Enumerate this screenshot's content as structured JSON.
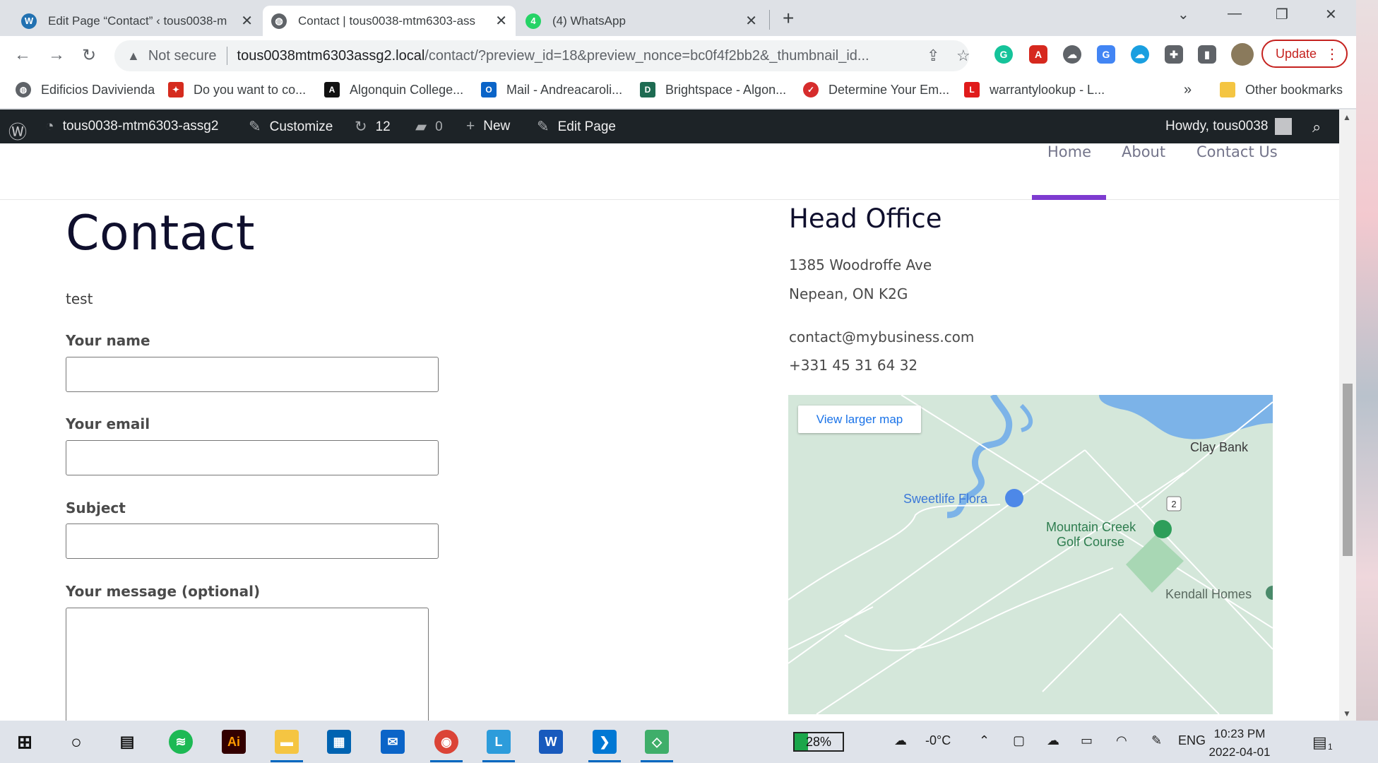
{
  "browser": {
    "tabs": [
      {
        "title": "Edit Page “Contact” ‹ tous0038-m",
        "icon": "wordpress-icon"
      },
      {
        "title": "Contact | tous0038-mtm6303-ass",
        "icon": "globe-icon"
      },
      {
        "title": "(4) WhatsApp",
        "icon": "whatsapp-icon"
      }
    ],
    "security_label": "Not secure",
    "url_host": "tous0038mtm6303assg2.local",
    "url_path": "/contact/?preview_id=18&preview_nonce=bc0f4f2bb2&_thumbnail_id...",
    "update_label": "Update",
    "bookmarks": [
      "Edificios Davivienda",
      "Do you want to co...",
      "Algonquin College...",
      "Mail - Andreacaroli...",
      "Brightspace - Algon...",
      "Determine Your Em...",
      "warrantylookup - L..."
    ],
    "bookmarks_overflow": "»",
    "other_bookmarks": "Other bookmarks"
  },
  "wp_admin_bar": {
    "site_name": "tous0038-mtm6303-assg2",
    "customize": "Customize",
    "updates_count": "12",
    "comments_count": "0",
    "new_label": "New",
    "edit_page": "Edit Page",
    "howdy": "Howdy, tous0038"
  },
  "site_nav": {
    "items": [
      "Home",
      "About",
      "Contact Us"
    ],
    "active": "Home",
    "accent_color": "#7e3bd0"
  },
  "content": {
    "title": "Contact",
    "intro": "test",
    "form": {
      "name_label": "Your name",
      "email_label": "Your email",
      "subject_label": "Subject",
      "message_label": "Your message (optional)",
      "name_value": "",
      "email_value": "",
      "subject_value": "",
      "message_value": ""
    }
  },
  "head_office": {
    "title": "Head Office",
    "address_line1": "1385 Woodroffe Ave",
    "address_line2": "Nepean, ON K2G",
    "email": "contact@mybusiness.com",
    "phone": "+331 45 31 64 32"
  },
  "map": {
    "view_larger": "View larger map",
    "labels": {
      "clay_bank": "Clay Bank",
      "sweetlife": "Sweetlife Flora",
      "golf_line1": "Mountain Creek",
      "golf_line2": "Golf Course",
      "kendall": "Kendall Homes",
      "route": "2"
    }
  },
  "taskbar": {
    "battery": "28%",
    "battery_level": 0.28,
    "weather": "-0°C",
    "language": "ENG",
    "time": "10:23 PM",
    "date": "2022-04-01",
    "notifications": "1"
  }
}
